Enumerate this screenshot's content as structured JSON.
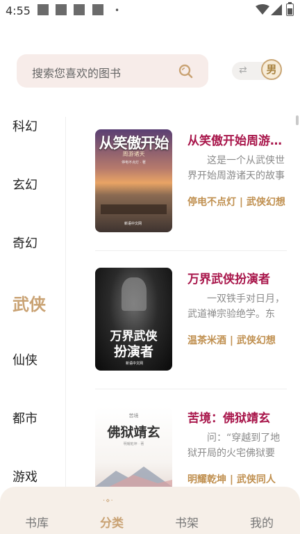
{
  "status_bar": {
    "time": "4:55",
    "dot": "•"
  },
  "search": {
    "placeholder": "搜索您喜欢的图书",
    "icon": "search-icon"
  },
  "gender_toggle": {
    "arrows": "⇄",
    "label": "男"
  },
  "categories": [
    {
      "label": "科幻",
      "active": false
    },
    {
      "label": "玄幻",
      "active": false
    },
    {
      "label": "奇幻",
      "active": false
    },
    {
      "label": "武侠",
      "active": true
    },
    {
      "label": "仙侠",
      "active": false
    },
    {
      "label": "都市",
      "active": false
    },
    {
      "label": "游戏",
      "active": false
    }
  ],
  "books": [
    {
      "title": "从笑傲开始周游诸天",
      "description": "这是一个从武侠世界开始周游诸天的故事",
      "meta": "停电不点灯 | 武侠幻想",
      "cover": {
        "title": "从笑傲开始",
        "subtitle": "周游诸天",
        "author_line": "停电不点灯 · 著",
        "publisher": "新语中文网"
      }
    },
    {
      "title": "万界武侠扮演者",
      "description": "一双铁手对日月，武道禅宗验绝学。东",
      "meta": "温茶米酒 | 武侠幻想",
      "cover": {
        "title": "万界武侠",
        "title2": "扮演者",
        "publisher": "新语中文网"
      }
    },
    {
      "title": "苦境：佛狱靖玄",
      "description": "问：“穿越到了地狱开局的火宅佛狱要",
      "meta": "明耀乾坤 | 武侠同人",
      "cover": {
        "title": "佛狱靖玄",
        "tag": "苦境",
        "author_line": "明耀乾坤 · 著"
      }
    }
  ],
  "bottom_nav": [
    {
      "label": "书库",
      "active": false
    },
    {
      "label": "分类",
      "active": true
    },
    {
      "label": "书架",
      "active": false
    },
    {
      "label": "我的",
      "active": false
    }
  ],
  "bottom_nav_mark": "·⋄·",
  "colors": {
    "accent": "#c9a273",
    "title": "#a8154a",
    "meta": "#c09050",
    "search_bg": "#f7ece9",
    "nav_bg": "#f6efe8"
  }
}
